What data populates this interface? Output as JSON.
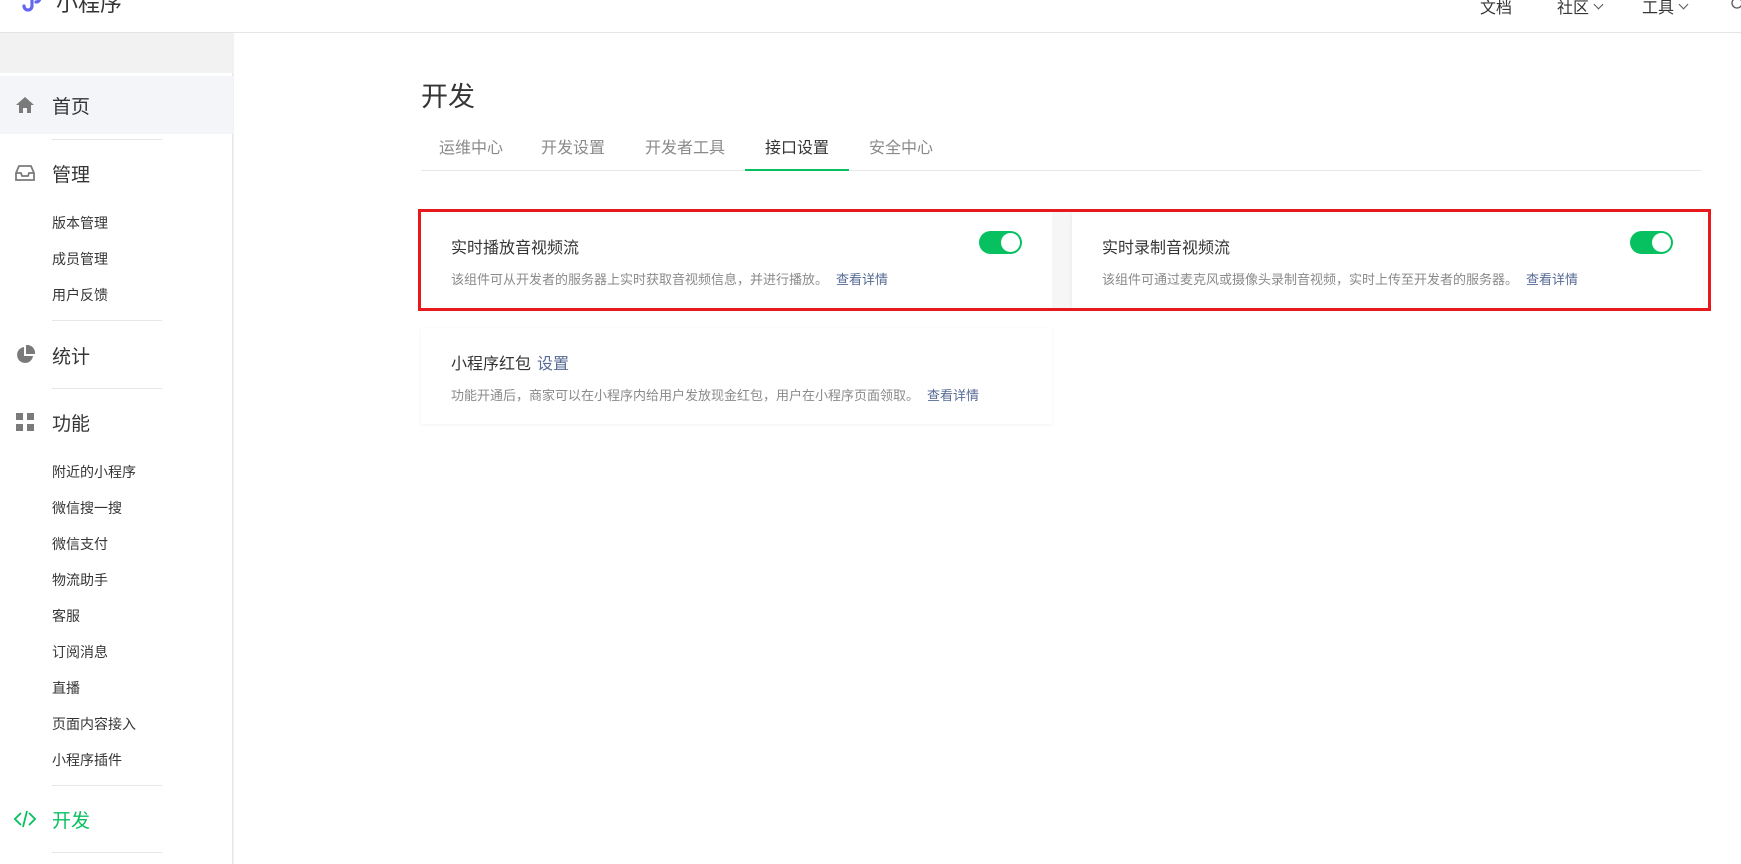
{
  "header": {
    "app_name": "小程序",
    "nav": [
      {
        "label": "文档",
        "has_caret": false
      },
      {
        "label": "社区",
        "has_caret": true
      },
      {
        "label": "工具",
        "has_caret": true
      }
    ]
  },
  "sidebar": {
    "home": {
      "label": "首页",
      "icon": "home-icon"
    },
    "manage": {
      "label": "管理",
      "icon": "inbox-icon",
      "items": [
        "版本管理",
        "成员管理",
        "用户反馈"
      ]
    },
    "stats": {
      "label": "统计",
      "icon": "pie-chart-icon"
    },
    "features": {
      "label": "功能",
      "icon": "grid-icon",
      "items": [
        "附近的小程序",
        "微信搜一搜",
        "微信支付",
        "物流助手",
        "客服",
        "订阅消息",
        "直播",
        "页面内容接入",
        "小程序插件"
      ]
    },
    "dev": {
      "label": "开发",
      "icon": "code-icon"
    }
  },
  "main": {
    "title": "开发",
    "tabs": [
      {
        "label": "运维中心",
        "active": false
      },
      {
        "label": "开发设置",
        "active": false
      },
      {
        "label": "开发者工具",
        "active": false
      },
      {
        "label": "接口设置",
        "active": true
      },
      {
        "label": "安全中心",
        "active": false
      }
    ],
    "cards": [
      {
        "title": "实时播放音视频流",
        "desc": "该组件可从开发者的服务器上实时获取音视频信息，并进行播放。",
        "link": "查看详情",
        "enabled": true
      },
      {
        "title": "实时录制音视频流",
        "desc": "该组件可通过麦克风或摄像头录制音视频，实时上传至开发者的服务器。",
        "link": "查看详情",
        "enabled": true
      },
      {
        "title": "小程序红包",
        "title_link": "设置",
        "desc": "功能开通后，商家可以在小程序内给用户发放现金红包，用户在小程序页面领取。",
        "link": "查看详情"
      }
    ]
  },
  "colors": {
    "accent": "#07c160",
    "link": "#576b95",
    "highlight": "#e8191d",
    "logo": "#6467f0"
  }
}
